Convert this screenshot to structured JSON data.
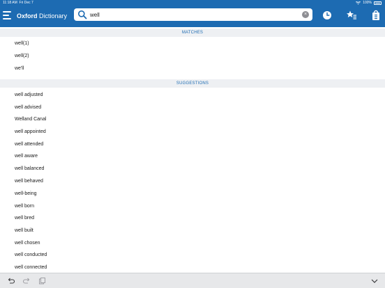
{
  "status_bar": {
    "time": "11:18 AM",
    "date": "Fri Dec 7",
    "battery": "100%",
    "icons": [
      "wifi-icon",
      "battery-icon"
    ]
  },
  "nav": {
    "brand_bold": "Oxford",
    "brand_regular": "Dictionary",
    "search_value": "well",
    "icons": [
      "menu-icon",
      "search-icon",
      "clear-icon",
      "history-icon",
      "favorites-icon",
      "bag-icon"
    ]
  },
  "matches": {
    "header": "MATCHES",
    "items": [
      "well(1)",
      "well(2)",
      "we'll"
    ]
  },
  "suggestions": {
    "header": "SUGGESTIONS",
    "items": [
      "well adjusted",
      "well advised",
      "Welland Canal",
      "well appointed",
      "well attended",
      "well aware",
      "well balanced",
      "well behaved",
      "well-being",
      "well born",
      "well bred",
      "well built",
      "well chosen",
      "well conducted",
      "well connected"
    ]
  },
  "toolbar": {
    "icons": [
      "undo-icon",
      "redo-icon",
      "clipboard-icon",
      "keyboard-dismiss-icon"
    ]
  },
  "colors": {
    "brand_blue": "#1d6bb2",
    "section_bg": "#eef0f3",
    "toolbar_bg": "#e7e8ea"
  }
}
